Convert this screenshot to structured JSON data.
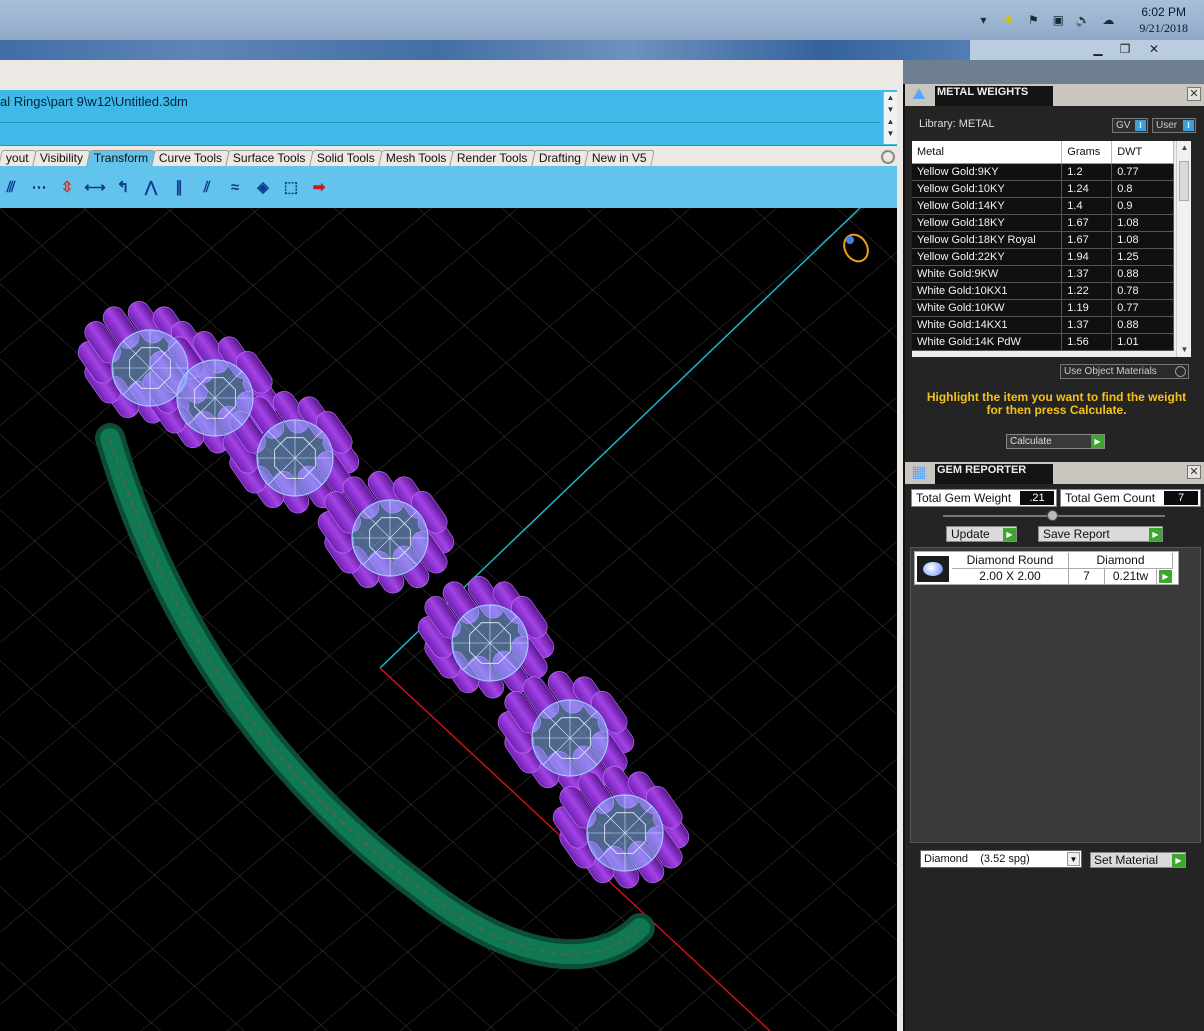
{
  "taskbar": {
    "time": "6:02 PM",
    "date": "9/21/2018",
    "tray_icons": [
      "chevron-up-icon",
      "network-icon",
      "flag-icon",
      "monitor-icon",
      "volume-icon",
      "cloud-icon"
    ]
  },
  "window": {
    "minimize": "▁",
    "restore": "❐",
    "close": "✕"
  },
  "document": {
    "path": "al Rings\\part 9\\w12\\Untitled.3dm"
  },
  "tabs": [
    {
      "label": "yout",
      "active": false
    },
    {
      "label": "Visibility",
      "active": false
    },
    {
      "label": "Transform",
      "active": true
    },
    {
      "label": "Curve Tools",
      "active": false
    },
    {
      "label": "Surface Tools",
      "active": false
    },
    {
      "label": "Solid Tools",
      "active": false
    },
    {
      "label": "Mesh Tools",
      "active": false
    },
    {
      "label": "Render Tools",
      "active": false
    },
    {
      "label": "Drafting",
      "active": false
    },
    {
      "label": "New in V5",
      "active": false
    }
  ],
  "metal_weights": {
    "title": "METAL WEIGHTS",
    "library_label": "Library: METAL",
    "gv_label": "GV",
    "user_label": "User",
    "columns": [
      "Metal",
      "Grams",
      "DWT"
    ],
    "rows": [
      [
        "Yellow Gold:9KY",
        "1.2",
        "0.77"
      ],
      [
        "Yellow Gold:10KY",
        "1.24",
        "0.8"
      ],
      [
        "Yellow Gold:14KY",
        "1.4",
        "0.9"
      ],
      [
        "Yellow Gold:18KY",
        "1.67",
        "1.08"
      ],
      [
        "Yellow Gold:18KY Royal",
        "1.67",
        "1.08"
      ],
      [
        "Yellow Gold:22KY",
        "1.94",
        "1.25"
      ],
      [
        "White Gold:9KW",
        "1.37",
        "0.88"
      ],
      [
        "White Gold:10KX1",
        "1.22",
        "0.78"
      ],
      [
        "White Gold:10KW",
        "1.19",
        "0.77"
      ],
      [
        "White Gold:14KX1",
        "1.37",
        "0.88"
      ],
      [
        "White Gold:14K PdW",
        "1.56",
        "1.01"
      ]
    ],
    "use_object_materials": "Use Object Materials",
    "hint": "Highlight the item you want to find the weight for then press Calculate.",
    "calculate": "Calculate"
  },
  "gem_reporter": {
    "title": "GEM REPORTER",
    "total_weight_label": "Total Gem Weight",
    "total_weight_value": ".21",
    "total_count_label": "Total Gem Count",
    "total_count_value": "7",
    "update": "Update",
    "save_report": "Save Report",
    "gem": {
      "shape": "Diamond Round",
      "type": "Diamond",
      "size": "2.00 X 2.00",
      "count": "7",
      "weight": "0.21tw"
    },
    "material": "Diamond    (3.52 spg)",
    "set_material": "Set Material"
  },
  "colors": {
    "accent": "#3fb9e8",
    "hint": "#f5c21a",
    "prong": "#8a2fc7",
    "band": "#0f6b4b",
    "gem": "#9ecbff"
  }
}
